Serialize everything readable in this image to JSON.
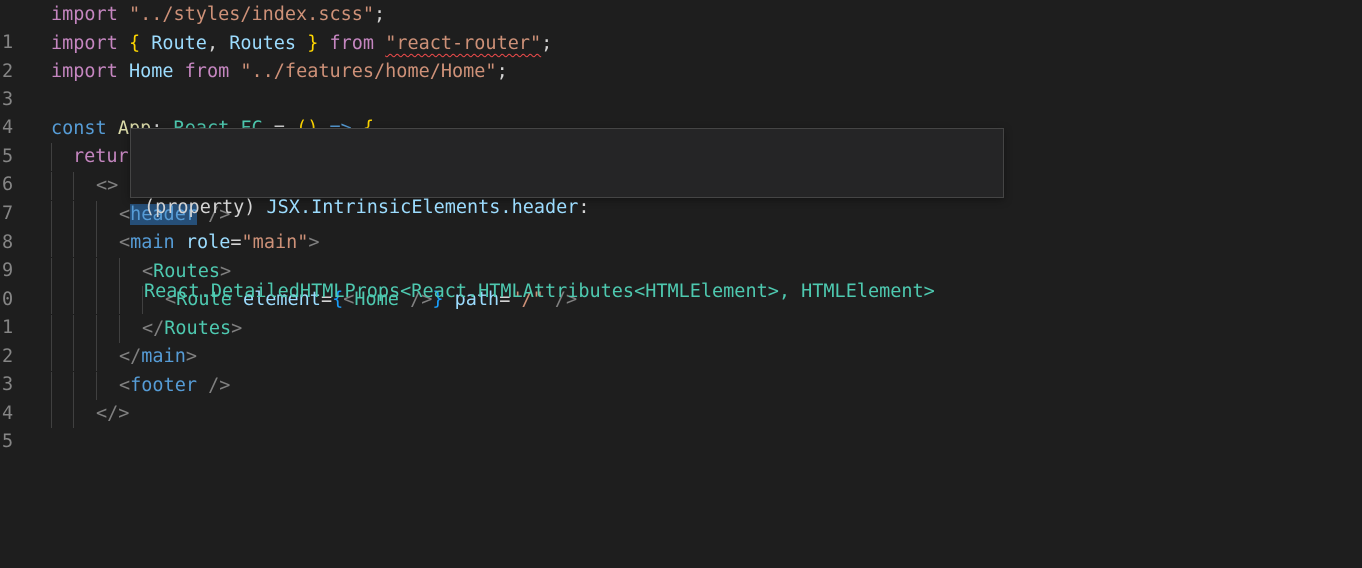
{
  "line_numbers": [
    "1",
    "2",
    "3",
    "4",
    "5",
    "6",
    "7",
    "8",
    "9",
    "0",
    "1",
    "2",
    "3",
    "4",
    "5"
  ],
  "code": {
    "l1": {
      "kw": "import",
      "str": "\"../styles/index.scss\"",
      "semi": ";"
    },
    "l2": {
      "kw": "import",
      "open": "{",
      "a": "Route",
      "comma": ",",
      "b": "Routes",
      "close": "}",
      "from": "from",
      "str": "\"react-router\"",
      "semi": ";"
    },
    "l3": {
      "kw": "import",
      "a": "Home",
      "from": "from",
      "str": "\"../features/home/Home\"",
      "semi": ";"
    },
    "l5": {
      "kw": "const",
      "name": "App",
      "colon": ":",
      "type": "React.FC",
      "eq": "=",
      "parens": "()",
      "arrow": "=>",
      "brace": "{"
    },
    "l6": {
      "kw": "return",
      "paren": "("
    },
    "l7": {
      "frag": "<>"
    },
    "l8": {
      "lt": "<",
      "tag": "header",
      "end": " />"
    },
    "l9": {
      "lt": "<",
      "tag": "main",
      "attr": "role",
      "eq": "=",
      "val": "\"main\"",
      "gt": ">"
    },
    "l10": {
      "lt": "<",
      "tag": "Routes",
      "gt": ">"
    },
    "l11": {
      "lt": "<",
      "tag": "Route",
      "attr": "element",
      "eq": "=",
      "open": "{",
      "inner_lt": "<",
      "inner": "Home",
      "inner_end": " />",
      "close": "}",
      "attr2": "path",
      "eq2": "=",
      "val2": "\"/\"",
      "end": " />"
    },
    "l12": {
      "lt": "</",
      "tag": "Routes",
      "gt": ">"
    },
    "l13": {
      "lt": "</",
      "tag": "main",
      "gt": ">"
    },
    "l14": {
      "lt": "<",
      "tag": "footer",
      "end": " />"
    },
    "l15": {
      "frag": "</>"
    }
  },
  "hover": {
    "line1_a": "(property) ",
    "line1_b": "JSX.IntrinsicElements.header",
    "line1_c": ":",
    "line2": "React.DetailedHTMLProps<React.HTMLAttributes<HTMLElement>, HTMLElement>"
  },
  "colors": {
    "background": "#1e1e1e",
    "keyword": "#569cd6",
    "import_keyword": "#c586c0",
    "string": "#ce9178",
    "variable": "#9cdcfe",
    "component": "#4ec9b0",
    "error_squiggle": "#f14c4c",
    "hover_bg": "#252526"
  }
}
